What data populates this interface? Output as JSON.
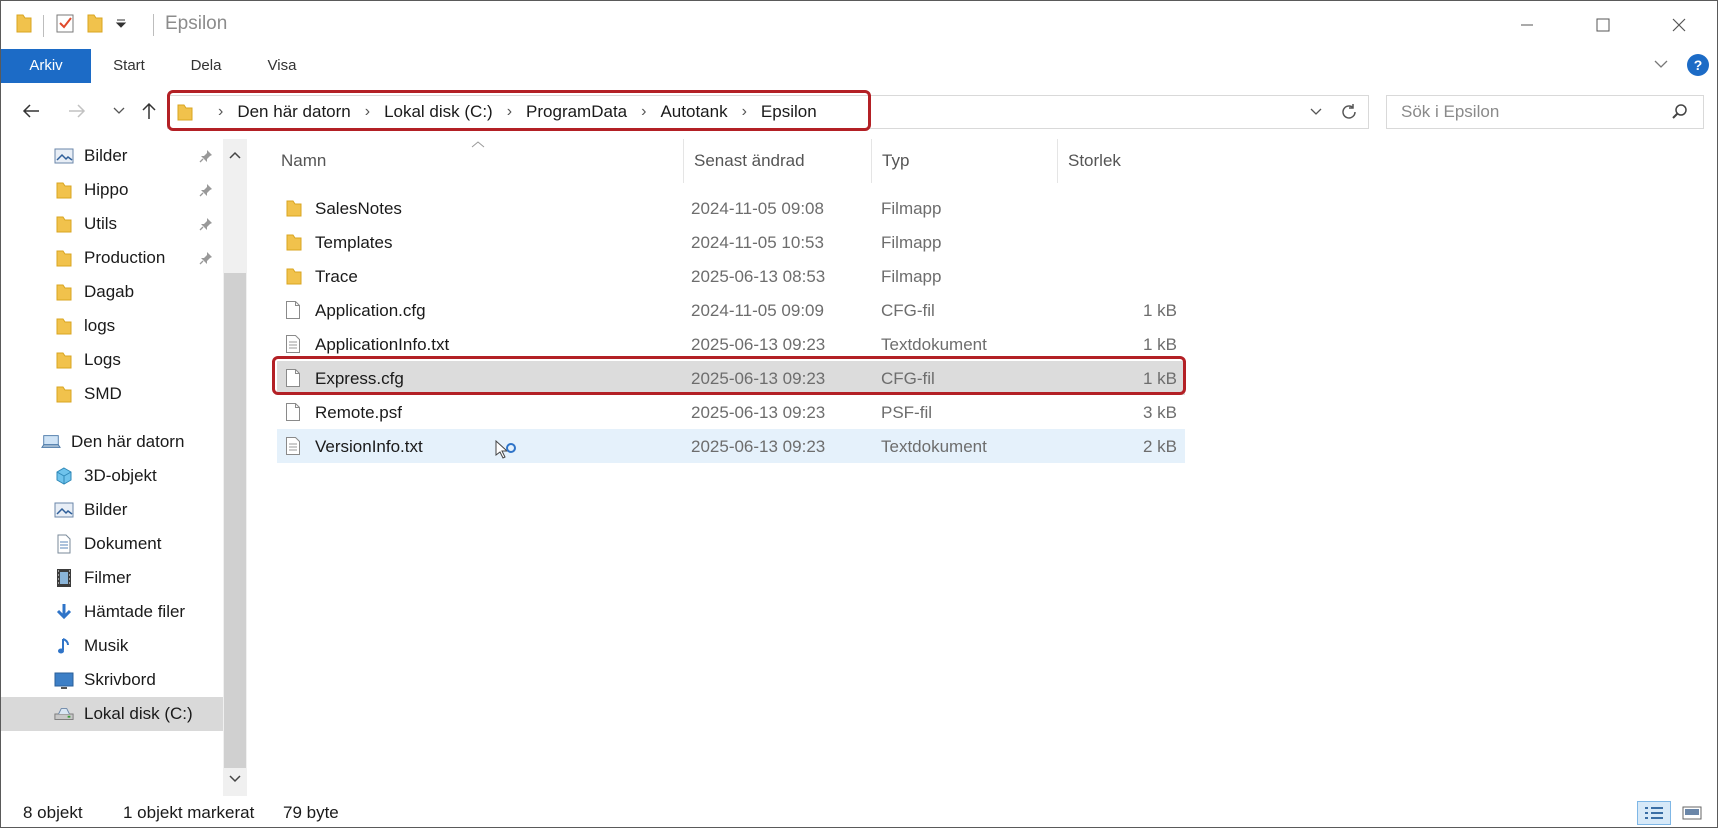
{
  "window": {
    "title": "Epsilon",
    "controls": [
      "minimize-icon",
      "maximize-icon",
      "close-icon"
    ]
  },
  "ribbon": {
    "tabs": [
      {
        "label": "Arkiv",
        "active": true
      },
      {
        "label": "Start"
      },
      {
        "label": "Dela"
      },
      {
        "label": "Visa"
      }
    ],
    "help_label": "?"
  },
  "address": {
    "crumbs": [
      "Den här datorn",
      "Lokal disk (C:)",
      "ProgramData",
      "Autotank",
      "Epsilon"
    ],
    "search_placeholder": "Sök i Epsilon"
  },
  "navpane": {
    "quick_access": [
      {
        "label": "Bilder",
        "icon": "pictures-icon",
        "pinned": true
      },
      {
        "label": "Hippo",
        "icon": "folder-icon",
        "pinned": true
      },
      {
        "label": "Utils",
        "icon": "folder-icon",
        "pinned": true
      },
      {
        "label": "Production",
        "icon": "folder-icon",
        "pinned": true
      },
      {
        "label": "Dagab",
        "icon": "folder-icon"
      },
      {
        "label": "logs",
        "icon": "folder-icon"
      },
      {
        "label": "Logs",
        "icon": "folder-icon"
      },
      {
        "label": "SMD",
        "icon": "folder-icon"
      }
    ],
    "this_pc": {
      "label": "Den här datorn",
      "icon": "computer-icon"
    },
    "this_pc_items": [
      {
        "label": "3D-objekt",
        "icon": "3d-objects-icon"
      },
      {
        "label": "Bilder",
        "icon": "pictures-icon"
      },
      {
        "label": "Dokument",
        "icon": "documents-icon"
      },
      {
        "label": "Filmer",
        "icon": "videos-icon"
      },
      {
        "label": "Hämtade filer",
        "icon": "downloads-icon"
      },
      {
        "label": "Musik",
        "icon": "music-icon"
      },
      {
        "label": "Skrivbord",
        "icon": "desktop-icon"
      },
      {
        "label": "Lokal disk (C:)",
        "icon": "drive-icon",
        "selected": true
      }
    ]
  },
  "filelist": {
    "columns": {
      "name": "Namn",
      "date": "Senast ändrad",
      "type": "Typ",
      "size": "Storlek"
    },
    "rows": [
      {
        "name": "SalesNotes",
        "date": "2024-11-05 09:08",
        "type": "Filmapp",
        "size": "",
        "icon": "folder-icon"
      },
      {
        "name": "Templates",
        "date": "2024-11-05 10:53",
        "type": "Filmapp",
        "size": "",
        "icon": "folder-icon"
      },
      {
        "name": "Trace",
        "date": "2025-06-13 08:53",
        "type": "Filmapp",
        "size": "",
        "icon": "folder-icon"
      },
      {
        "name": "Application.cfg",
        "date": "2024-11-05 09:09",
        "type": "CFG-fil",
        "size": "1 kB",
        "icon": "file-icon"
      },
      {
        "name": "ApplicationInfo.txt",
        "date": "2025-06-13 09:23",
        "type": "Textdokument",
        "size": "1 kB",
        "icon": "text-file-icon"
      },
      {
        "name": "Express.cfg",
        "date": "2025-06-13 09:23",
        "type": "CFG-fil",
        "size": "1 kB",
        "icon": "file-icon",
        "selected": true
      },
      {
        "name": "Remote.psf",
        "date": "2025-06-13 09:23",
        "type": "PSF-fil",
        "size": "3 kB",
        "icon": "file-icon"
      },
      {
        "name": "VersionInfo.txt",
        "date": "2025-06-13 09:23",
        "type": "Textdokument",
        "size": "2 kB",
        "icon": "text-file-icon",
        "hover": true
      }
    ]
  },
  "status": {
    "count": "8 objekt",
    "selection": "1 objekt markerat",
    "size": "79 byte"
  },
  "colors": {
    "accent": "#1c6bc6",
    "highlight_outline": "#b32025",
    "folder": "#f1c24c"
  }
}
